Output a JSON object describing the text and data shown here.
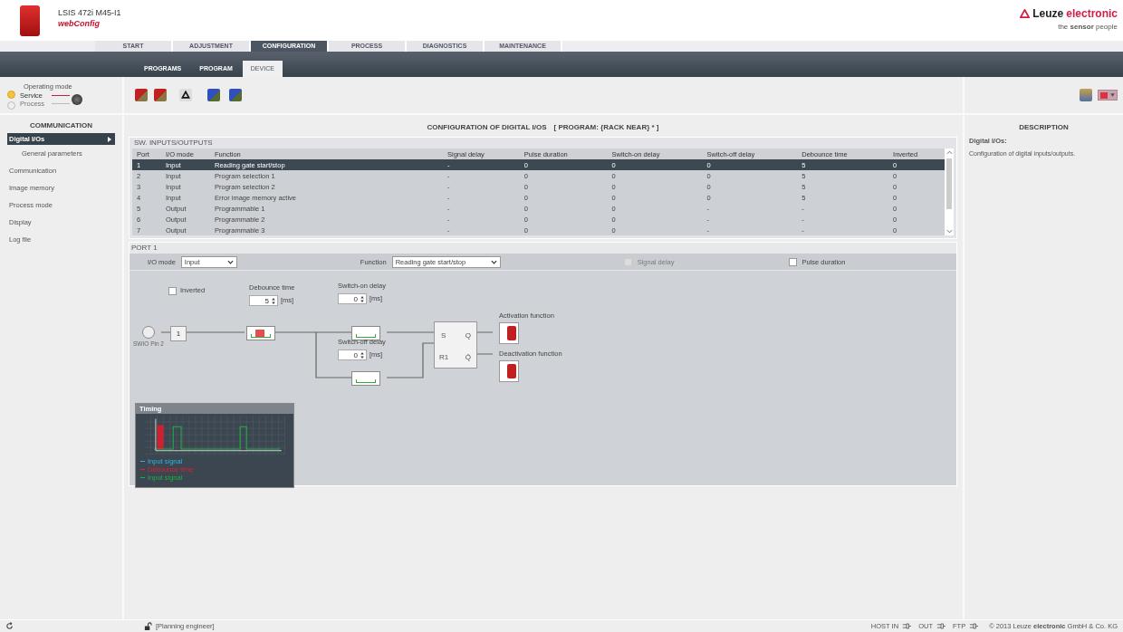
{
  "header": {
    "device": "LSIS 472i M45-I1",
    "app": "webConfig",
    "brand": "Leuze",
    "brand_accent": "electronic",
    "tagline": "the **sensor** people"
  },
  "nav_tabs": [
    {
      "label": "START",
      "selected": false
    },
    {
      "label": "ADJUSTMENT",
      "selected": false
    },
    {
      "label": "CONFIGURATION",
      "selected": true
    },
    {
      "label": "PROCESS",
      "selected": false
    },
    {
      "label": "DIAGNOSTICS",
      "selected": false
    },
    {
      "label": "MAINTENANCE",
      "selected": false
    }
  ],
  "sub_tabs": [
    {
      "label": "PROGRAMS",
      "selected": false
    },
    {
      "label": "PROGRAM",
      "selected": false
    },
    {
      "label": "DEVICE",
      "selected": true
    }
  ],
  "operating_mode": {
    "title": "Operating mode",
    "modes": [
      {
        "label": "Service",
        "selected": true
      },
      {
        "label": "Process",
        "selected": false
      }
    ]
  },
  "sidebar": {
    "title": "COMMUNICATION",
    "items": [
      {
        "label": "Digital I/Os",
        "selected": true,
        "children": [
          {
            "label": "General parameters",
            "selected": false
          }
        ]
      },
      {
        "label": "Communication",
        "selected": false
      },
      {
        "label": "Image memory",
        "selected": false
      },
      {
        "label": "Process mode",
        "selected": false
      },
      {
        "label": "Display",
        "selected": false
      },
      {
        "label": "Log file",
        "selected": false
      }
    ]
  },
  "main": {
    "title": "CONFIGURATION OF DIGITAL I/OS",
    "program": "[ PROGRAM: {RACK NEAR} * ]"
  },
  "table": {
    "title": "SW. INPUTS/OUTPUTS",
    "columns": [
      "Port",
      "I/O mode",
      "Function",
      "Signal delay",
      "Pulse duration",
      "Switch-on delay",
      "Switch-off delay",
      "Debounce time",
      "Inverted"
    ],
    "rows": [
      {
        "selected": true,
        "cells": [
          "1",
          "Input",
          "Reading gate start/stop",
          "-",
          "0",
          "0",
          "0",
          "5",
          "0"
        ]
      },
      {
        "selected": false,
        "cells": [
          "2",
          "Input",
          "Program selection 1",
          "-",
          "0",
          "0",
          "0",
          "5",
          "0"
        ]
      },
      {
        "selected": false,
        "cells": [
          "3",
          "Input",
          "Program selection 2",
          "-",
          "0",
          "0",
          "0",
          "5",
          "0"
        ]
      },
      {
        "selected": false,
        "cells": [
          "4",
          "Input",
          "Error image memory active",
          "-",
          "0",
          "0",
          "0",
          "5",
          "0"
        ]
      },
      {
        "selected": false,
        "cells": [
          "5",
          "Output",
          "Programmable 1",
          "-",
          "0",
          "0",
          "-",
          "-",
          "0"
        ]
      },
      {
        "selected": false,
        "cells": [
          "6",
          "Output",
          "Programmable 2",
          "-",
          "0",
          "0",
          "-",
          "-",
          "0"
        ]
      },
      {
        "selected": false,
        "cells": [
          "7",
          "Output",
          "Programmable 3",
          "-",
          "0",
          "0",
          "-",
          "-",
          "0"
        ]
      }
    ]
  },
  "port": {
    "title": "PORT 1",
    "io_mode_label": "I/O mode",
    "io_mode": "Input",
    "function_label": "Function",
    "function": "Reading gate start/stop",
    "signal_delay": {
      "label": "Signal delay",
      "checked": false,
      "disabled": true
    },
    "pulse_duration": {
      "label": "Pulse duration",
      "checked": false,
      "disabled": false
    },
    "inverted": {
      "label": "Inverted",
      "checked": false
    },
    "pin_label": "SWIO Pin 2",
    "gate": "1",
    "debounce": {
      "label": "Debounce time",
      "value": "5",
      "unit": "[ms]"
    },
    "switch_on": {
      "label": "Switch-on delay",
      "value": "0",
      "unit": "[ms]"
    },
    "switch_off": {
      "label": "Switch-off delay",
      "value": "0",
      "unit": "[ms]"
    },
    "flipflop": {
      "s": "S",
      "r": "R1",
      "q": "Q",
      "qn": "Q̄"
    },
    "activation": "Activation function",
    "deactivation": "Deactivation function",
    "timing": {
      "title": "Timing",
      "legend": [
        {
          "label": "Input signal",
          "color": "#2fb5d8"
        },
        {
          "label": "Debounce time",
          "color": "#e02030"
        },
        {
          "label": "Input signal",
          "color": "#20b040"
        }
      ]
    }
  },
  "description": {
    "title": "DESCRIPTION",
    "heading": "Digital I/Os:",
    "text": "Configuration of digital inputs/outputs."
  },
  "status_bar": {
    "user": "[Planning engineer]",
    "indicators": [
      "HOST IN",
      "OUT",
      "FTP"
    ],
    "copyright": "© 2013 Leuze **electronic** GmbH & Co. KG"
  }
}
